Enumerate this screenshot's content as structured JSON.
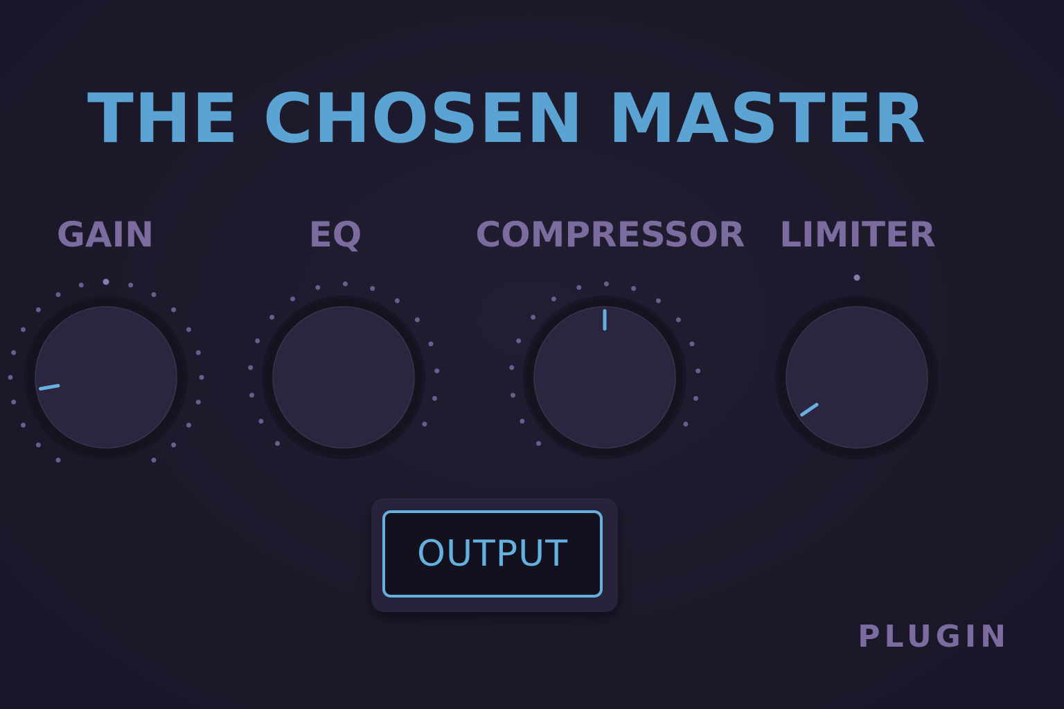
{
  "plugin": {
    "title": "THE CHOSEN MASTER",
    "brand_label": "PLUGIN",
    "output_button_label": "OUTPUT"
  },
  "knobs": [
    {
      "id": "gain",
      "label": "GAIN",
      "value": 0.13,
      "scale": "dense"
    },
    {
      "id": "eq",
      "label": "EQ",
      "value": null,
      "scale": "sparse"
    },
    {
      "id": "compressor",
      "label": "COMPRESSOR",
      "value": 0.5,
      "scale": "sparse"
    },
    {
      "id": "limiter",
      "label": "LIMITER",
      "value": 0.04,
      "scale": "top-dot"
    }
  ],
  "colors": {
    "title": "#5aa3d3",
    "label": "#7c6b9e",
    "accent": "#66b0e0",
    "tick": "#6b5d8f",
    "knob_face": "#2b2540",
    "knob_rim": "#16131f",
    "brand": "#7c6b9e"
  }
}
